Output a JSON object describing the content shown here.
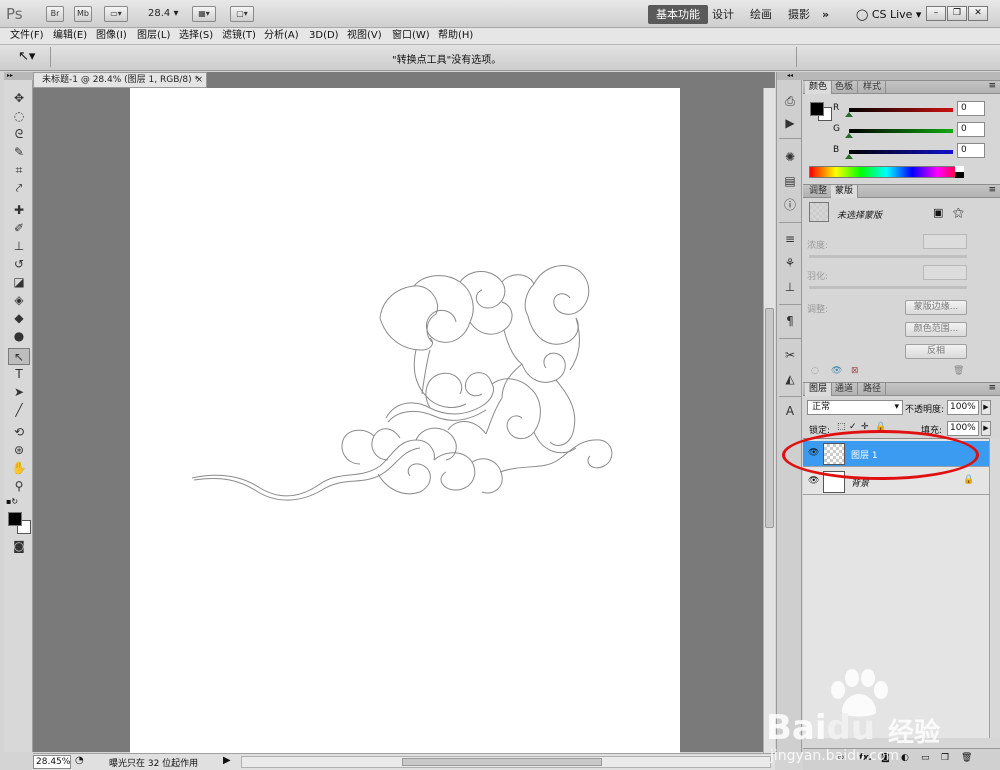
{
  "appbar": {
    "logo": "Ps",
    "br_label": "Br",
    "mb_label": "Mb",
    "zoom_value": "28.4",
    "workspaces": [
      "基本功能",
      "设计",
      "绘画",
      "摄影"
    ],
    "more": "»",
    "cs_live": "CS Live"
  },
  "menu": [
    "文件(F)",
    "编辑(E)",
    "图像(I)",
    "图层(L)",
    "选择(S)",
    "滤镜(T)",
    "分析(A)",
    "3D(D)",
    "视图(V)",
    "窗口(W)",
    "帮助(H)"
  ],
  "options_bar": {
    "message": "\"转换点工具\"没有选项。"
  },
  "document": {
    "tab_title": "未标题-1 @ 28.4% (图层 1, RGB/8) *",
    "close_glyph": "×"
  },
  "status": {
    "zoom": "28.45%",
    "message": "曝光只在 32 位起作用"
  },
  "color_panel": {
    "tabs": [
      "颜色",
      "色板",
      "样式"
    ],
    "labels": [
      "R",
      "G",
      "B"
    ],
    "values": [
      "0",
      "0",
      "0"
    ],
    "colors": [
      "#cc1111",
      "#11aa11",
      "#1111cc"
    ]
  },
  "masks_panel": {
    "tabs": [
      "调整",
      "蒙版"
    ],
    "no_mask": "未选择蒙版",
    "density_label": "浓度:",
    "feather_label": "羽化:",
    "refine_label": "调整:",
    "btn_edge": "蒙版边缘...",
    "btn_color_range": "颜色范围...",
    "btn_invert": "反相"
  },
  "layers_panel": {
    "tabs": [
      "图层",
      "通道",
      "路径"
    ],
    "blend_mode": "正常",
    "opacity_label": "不透明度:",
    "opacity_value": "100%",
    "lock_label": "锁定:",
    "fill_label": "填充:",
    "fill_value": "100%",
    "layers": [
      {
        "name": "图层 1",
        "selected": true
      },
      {
        "name": "背景",
        "selected": false
      }
    ],
    "fx_label": "fx."
  },
  "watermark": {
    "brand": "Bai",
    "brand2": "du",
    "cn": "经验",
    "url": "jingyan.baidu.com"
  }
}
